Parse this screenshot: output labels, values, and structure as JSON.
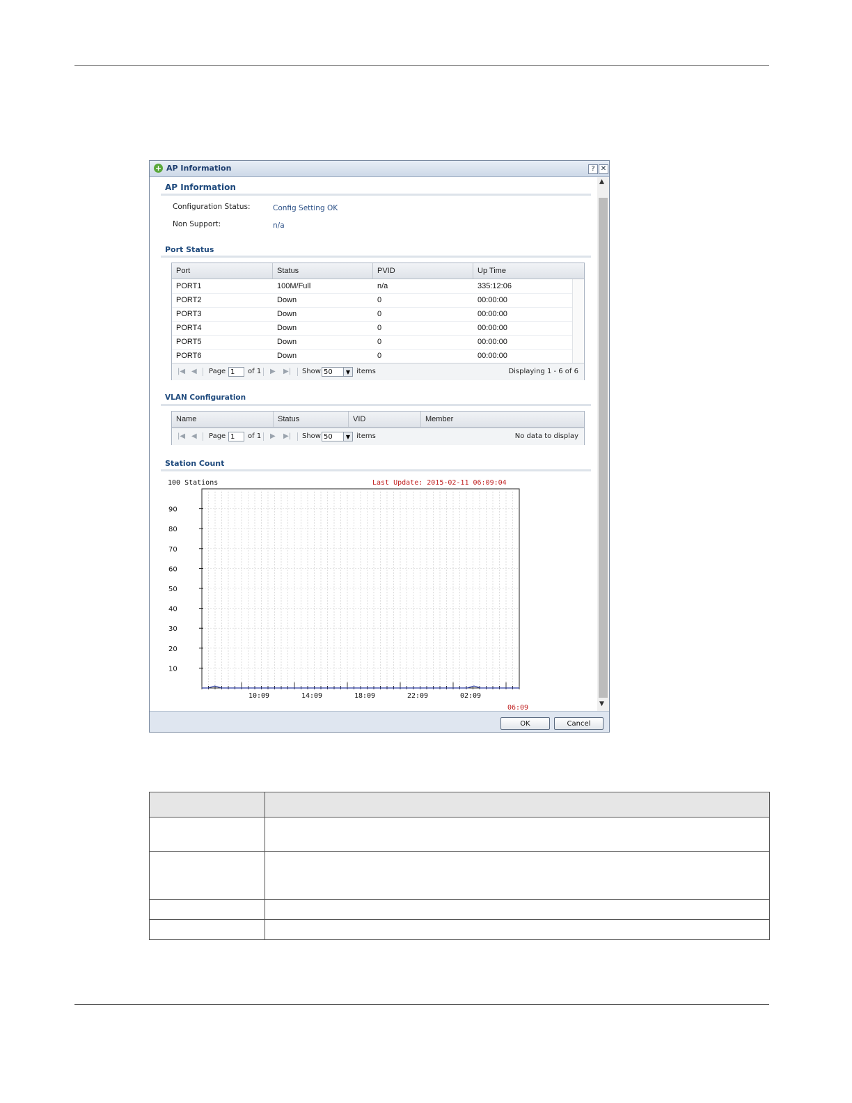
{
  "dialog": {
    "title": "AP Information",
    "help_icon": "question-icon",
    "close_icon": "close-icon"
  },
  "ap_info": {
    "section_title": "AP Information",
    "config_status_label": "Configuration Status:",
    "config_status_value": "Config Setting OK",
    "non_support_label": "Non Support:",
    "non_support_value": "n/a"
  },
  "port_status": {
    "section_title": "Port Status",
    "columns": [
      "Port",
      "Status",
      "PVID",
      "Up Time"
    ],
    "rows": [
      [
        "PORT1",
        "100M/Full",
        "n/a",
        "335:12:06"
      ],
      [
        "PORT2",
        "Down",
        "0",
        "00:00:00"
      ],
      [
        "PORT3",
        "Down",
        "0",
        "00:00:00"
      ],
      [
        "PORT4",
        "Down",
        "0",
        "00:00:00"
      ],
      [
        "PORT5",
        "Down",
        "0",
        "00:00:00"
      ],
      [
        "PORT6",
        "Down",
        "0",
        "00:00:00"
      ]
    ],
    "pager": {
      "page_label": "Page",
      "page_value": "1",
      "of_label": "of 1",
      "show_label": "Show",
      "show_value": "50",
      "items_label": "items",
      "display_text": "Displaying 1 - 6 of 6"
    }
  },
  "vlan": {
    "section_title": "VLAN Configuration",
    "columns": [
      "Name",
      "Status",
      "VID",
      "Member"
    ],
    "pager": {
      "page_label": "Page",
      "page_value": "1",
      "of_label": "of 1",
      "show_label": "Show",
      "show_value": "50",
      "items_label": "items",
      "display_text": "No data to display"
    }
  },
  "station_count": {
    "section_title": "Station Count"
  },
  "chart_data": {
    "type": "line",
    "title": "100 Stations",
    "annotation": "Last Update: 2015-02-11 06:09:04",
    "y_ticks": [
      90,
      80,
      70,
      60,
      50,
      40,
      30,
      20,
      10
    ],
    "x_ticks": [
      "10:09",
      "14:09",
      "18:09",
      "22:09",
      "02:09",
      "06:09"
    ],
    "ylim": [
      0,
      100
    ],
    "grid": true,
    "series": [
      {
        "values": [
          0,
          0,
          1,
          0,
          0,
          0,
          0,
          0,
          0,
          0,
          0,
          0,
          0,
          0,
          0,
          0,
          0,
          0,
          0,
          0,
          0,
          0,
          0,
          0,
          0,
          0,
          0,
          0,
          0,
          0,
          0,
          0,
          0,
          0,
          0,
          0,
          0,
          0,
          0,
          0,
          0,
          0,
          1,
          0,
          0,
          0,
          0,
          0,
          0,
          0
        ]
      }
    ],
    "colors": {
      "line": "#2a3aa0",
      "annotation": "#c02020"
    }
  },
  "buttons": {
    "ok": "OK",
    "cancel": "Cancel"
  }
}
